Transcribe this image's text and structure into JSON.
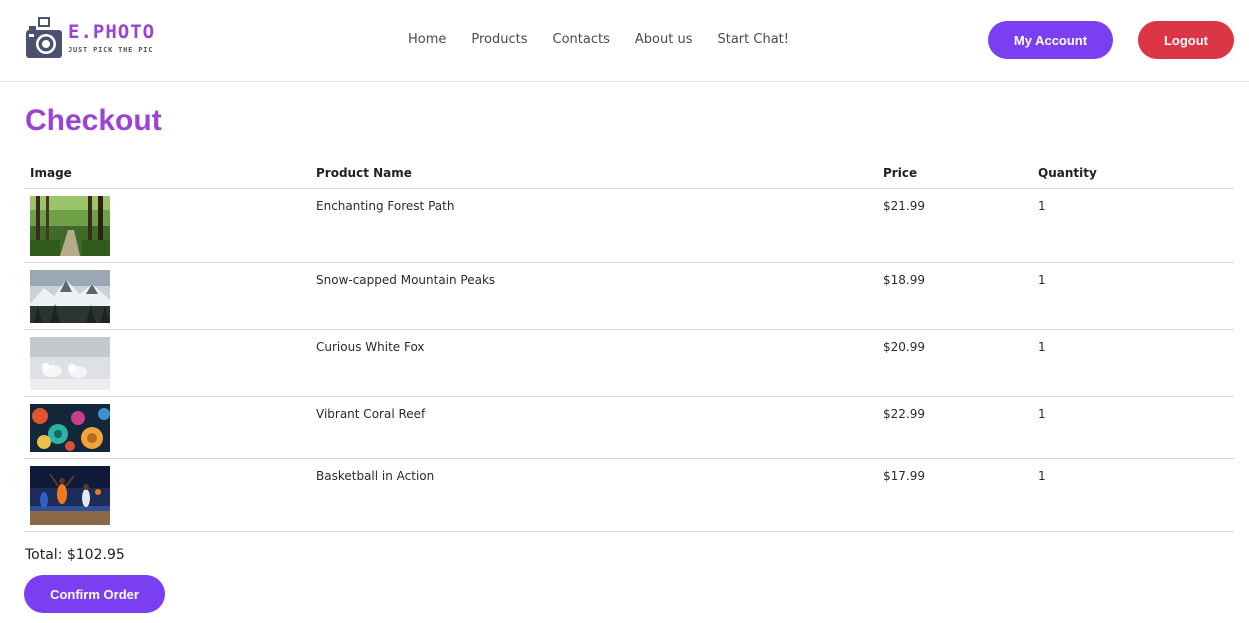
{
  "brand": {
    "name": "E.PHOTO",
    "tagline": "JUST PICK THE PIC"
  },
  "nav": {
    "items": [
      "Home",
      "Products",
      "Contacts",
      "About us",
      "Start Chat!"
    ]
  },
  "header": {
    "account_label": "My Account",
    "logout_label": "Logout"
  },
  "main": {
    "title": "Checkout"
  },
  "table": {
    "headers": {
      "image": "Image",
      "product_name": "Product Name",
      "price": "Price",
      "quantity": "Quantity"
    },
    "rows": [
      {
        "name": "Enchanting Forest Path",
        "price": "$21.99",
        "quantity": "1",
        "image": "forest-path-photo"
      },
      {
        "name": "Snow-capped Mountain Peaks",
        "price": "$18.99",
        "quantity": "1",
        "image": "mountain-peaks-photo"
      },
      {
        "name": "Curious White Fox",
        "price": "$20.99",
        "quantity": "1",
        "image": "white-fox-photo"
      },
      {
        "name": "Vibrant Coral Reef",
        "price": "$22.99",
        "quantity": "1",
        "image": "coral-reef-photo"
      },
      {
        "name": "Basketball in Action",
        "price": "$17.99",
        "quantity": "1",
        "image": "basketball-photo"
      }
    ]
  },
  "summary": {
    "total_text": "Total: $102.95",
    "confirm_label": "Confirm Order"
  },
  "colors": {
    "brand_purple": "#9b44d4",
    "button_purple": "#7b3ff2",
    "logout_red": "#dc3545"
  }
}
